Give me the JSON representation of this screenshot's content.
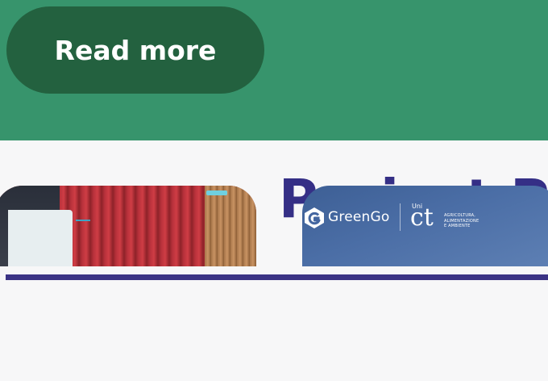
{
  "hero": {
    "read_more_label": "Read more",
    "colors": {
      "background": "#37946c",
      "button": "#23613f"
    }
  },
  "section": {
    "title": "Project Pr",
    "colors": {
      "title": "#352f86",
      "divider": "#3b3385"
    }
  },
  "cards": [
    {
      "image": "conference-hall-photo"
    },
    {
      "image": "greengo-unict-banner",
      "logo": {
        "brand": "GreenGo",
        "uni_prefix": "Uni",
        "uni_mark": "ct",
        "department_lines": [
          "AGRICOLTURA,",
          "ALIMENTAZIONE",
          "E AMBIENTE"
        ]
      }
    }
  ]
}
